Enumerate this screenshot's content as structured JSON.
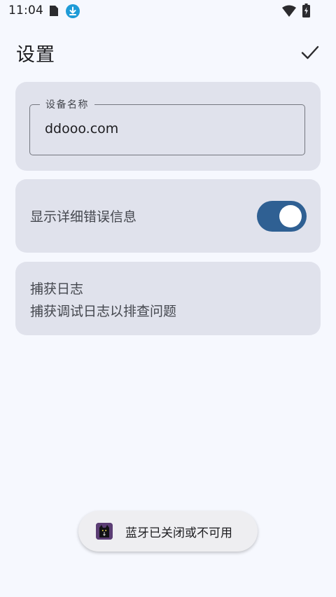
{
  "status_bar": {
    "time": "11:04",
    "icons": [
      "sim-card-icon",
      "download-icon",
      "wifi-icon",
      "battery-charging-icon"
    ]
  },
  "header": {
    "title": "设置",
    "confirm_icon": "check-icon"
  },
  "device_name": {
    "label": "设备名称",
    "value": "ddooo.com"
  },
  "error_details": {
    "label": "显示详细错误信息",
    "enabled": true
  },
  "capture_logs": {
    "title": "捕获日志",
    "subtitle": "捕获调试日志以排查问题"
  },
  "toast": {
    "app_icon": "cat-app-icon",
    "message": "蓝牙已关闭或不可用"
  },
  "colors": {
    "background": "#f6f8fe",
    "card": "#e0e2ec",
    "accent": "#2f6093",
    "download_badge": "#1e9bd7",
    "text_primary": "#1c1c1f",
    "text_secondary": "#44474e",
    "toast_icon": "#5b3d74"
  }
}
